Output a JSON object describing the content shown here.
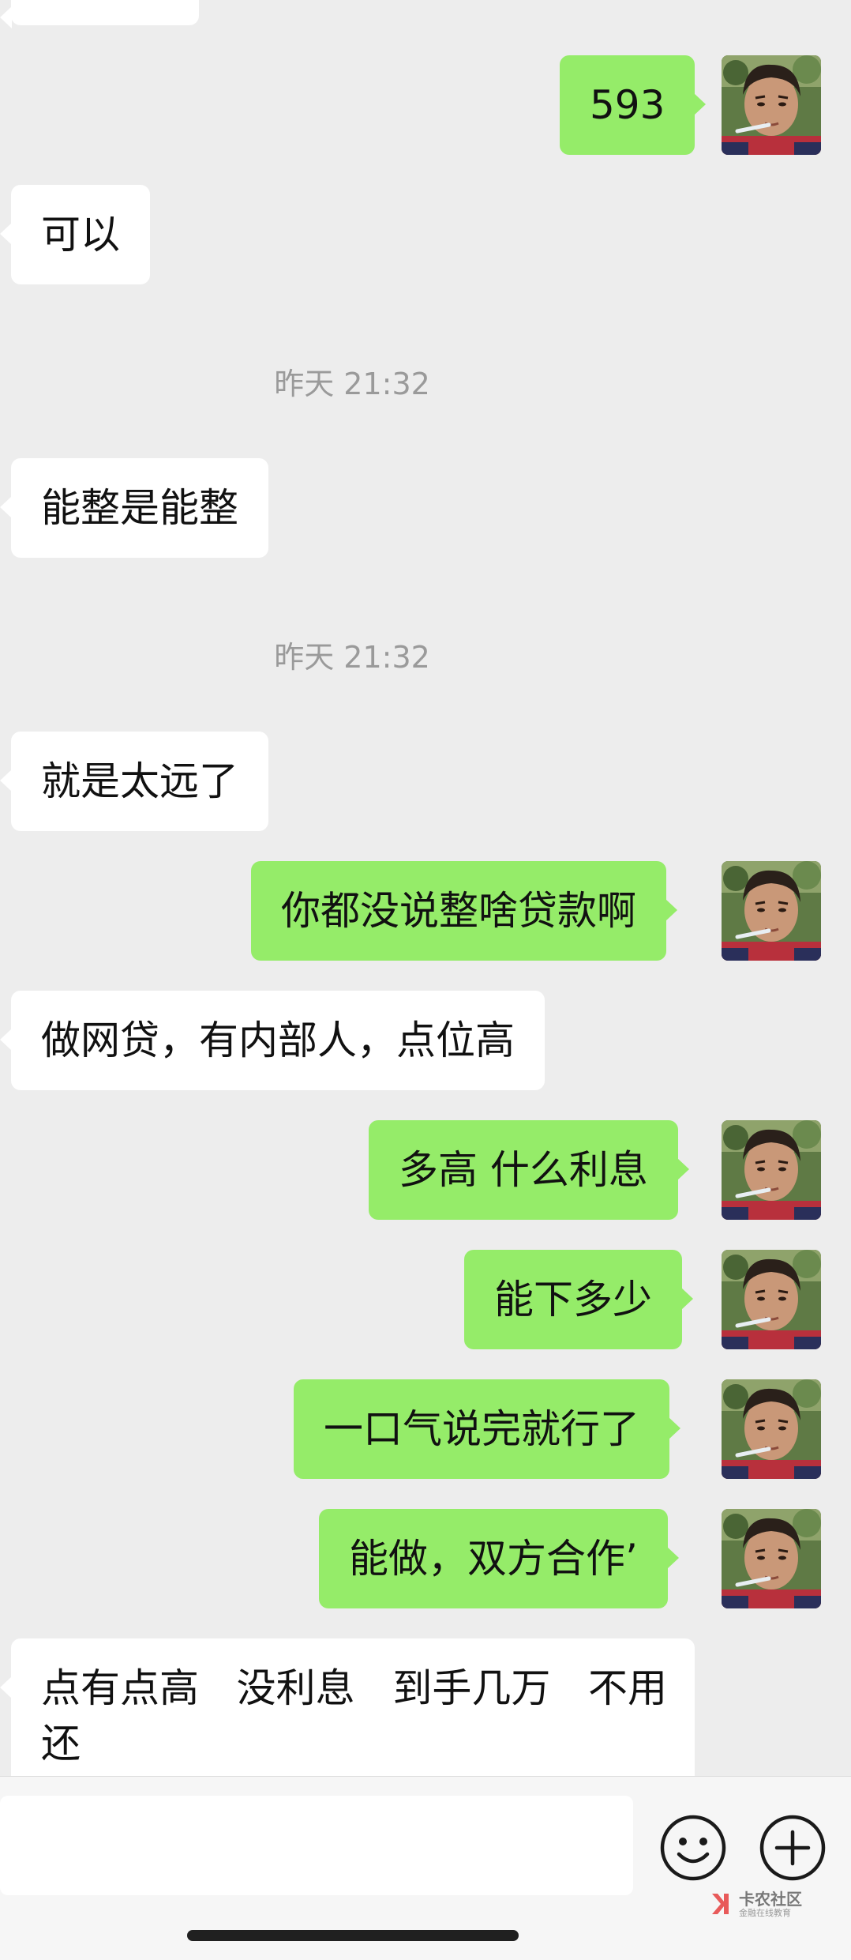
{
  "messages": [
    {
      "text": "593"
    },
    {
      "text": "可以"
    },
    {
      "text": "能整是能整"
    },
    {
      "text": "就是太远了"
    },
    {
      "text": "你都没说整啥贷款啊"
    },
    {
      "text": "做网贷，有内部人，点位高"
    },
    {
      "text": "多高 什么利息"
    },
    {
      "text": "能下多少"
    },
    {
      "text": "一口气说完就行了"
    },
    {
      "text": "能做，双方合作’"
    },
    {
      "line1": "点有点高   没利息   到手几万   不用",
      "line2": "还"
    }
  ],
  "timestamps": [
    "昨天 21:32",
    "昨天 21:32"
  ],
  "input": {
    "value": ""
  },
  "icons": {
    "emoji": "emoji-icon",
    "plus": "plus-icon"
  },
  "watermark": {
    "main": "卡农社区",
    "sub": "金融在线教育"
  },
  "colors": {
    "background": "#ededed",
    "outgoing": "#95ec69",
    "incoming": "#ffffff",
    "timestamp": "#9a9a9a"
  }
}
